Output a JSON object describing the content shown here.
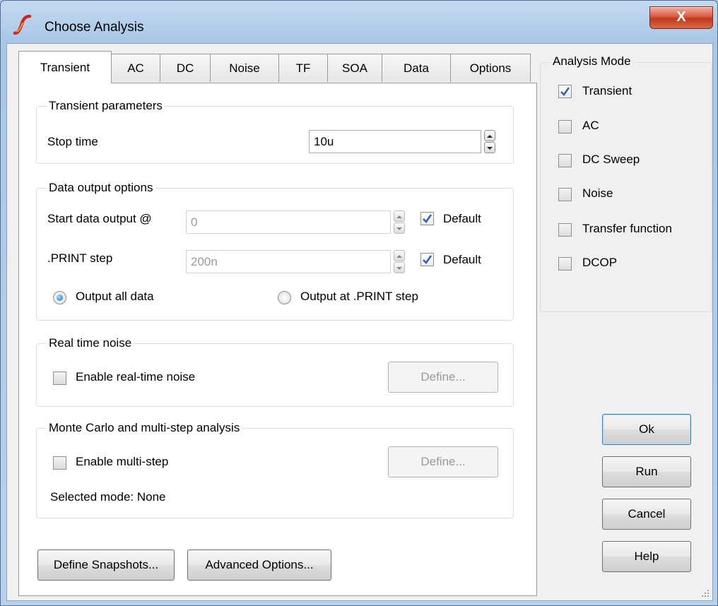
{
  "window": {
    "title": "Choose Analysis",
    "close_label": "X"
  },
  "tabs": [
    {
      "label": "Transient",
      "active": true
    },
    {
      "label": "AC"
    },
    {
      "label": "DC"
    },
    {
      "label": "Noise"
    },
    {
      "label": "TF"
    },
    {
      "label": "SOA"
    },
    {
      "label": "Data"
    },
    {
      "label": "Options"
    }
  ],
  "transient_params": {
    "legend": "Transient parameters",
    "stop_time_label": "Stop time",
    "stop_time_value": "10u"
  },
  "data_output": {
    "legend": "Data output options",
    "start_label": "Start data output @",
    "start_value": "0",
    "start_default_label": "Default",
    "print_label": ".PRINT step",
    "print_value": "200n",
    "print_default_label": "Default",
    "radio_all_label": "Output all data",
    "radio_print_label": "Output at .PRINT step"
  },
  "realtime_noise": {
    "legend": "Real time noise",
    "enable_label": "Enable real-time noise",
    "define_label": "Define..."
  },
  "monte_carlo": {
    "legend": "Monte Carlo and multi-step analysis",
    "enable_label": "Enable multi-step",
    "define_label": "Define...",
    "selected_mode": "Selected mode: None"
  },
  "bottom_buttons": {
    "snapshots_label": "Define Snapshots...",
    "advanced_label": "Advanced Options..."
  },
  "analysis_mode": {
    "legend": "Analysis Mode",
    "items": [
      {
        "label": "Transient",
        "checked": true
      },
      {
        "label": "AC",
        "checked": false
      },
      {
        "label": "DC Sweep",
        "checked": false
      },
      {
        "label": "Noise",
        "checked": false
      },
      {
        "label": "Transfer function",
        "checked": false
      },
      {
        "label": "DCOP",
        "checked": false
      }
    ]
  },
  "actions": {
    "ok_label": "Ok",
    "run_label": "Run",
    "cancel_label": "Cancel",
    "help_label": "Help"
  },
  "colors": {
    "accent": "#3c7fb1",
    "close_red": "#c23a1f",
    "check_blue": "#3b5fa8"
  }
}
